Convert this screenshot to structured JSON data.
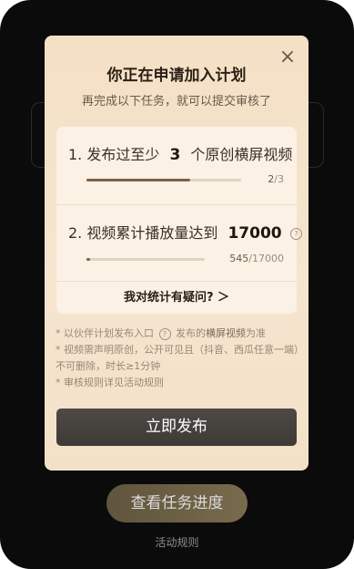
{
  "background": {
    "progress_button": "查看任务进度",
    "rules_link": "活动规则"
  },
  "modal": {
    "title": "你正在申请加入计划",
    "subtitle": "再完成以下任务，就可以提交审核了",
    "close_icon": "close-icon",
    "tasks": [
      {
        "prefix": "1. 发布过至少",
        "highlight": "3",
        "suffix": "个原创横屏视频",
        "progress_current": "2",
        "progress_sep": "/",
        "progress_total": "3",
        "progress_fraction": 0.67
      },
      {
        "prefix": "2. 视频累计播放量达到",
        "highlight": "17000",
        "suffix": "",
        "help_icon": "question-circle-icon",
        "progress_current": "545",
        "progress_sep": "/",
        "progress_total": "17000",
        "progress_fraction": 0.032
      }
    ],
    "question_link": "我对统计有疑问? ＞",
    "notes": {
      "line1_a": "* 以伙伴计划发布入口",
      "line1_b": "发布的",
      "line1_hl": "横屏视频",
      "line1_c": "为准",
      "line2": "* 视频需声明原创，公开可见且（抖音、西瓜任意一端）不可删除，时长≥1分钟",
      "line3": "* 审核规则详见活动规则"
    },
    "primary_button": "立即发布"
  }
}
